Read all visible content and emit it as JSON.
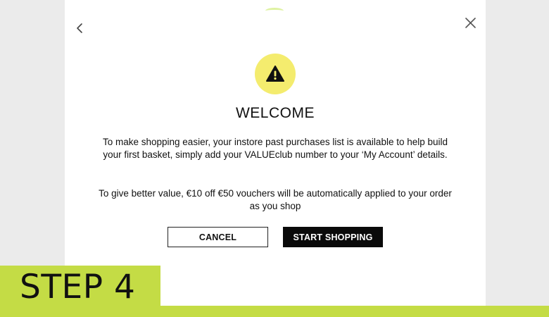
{
  "modal": {
    "title": "WELCOME",
    "paragraph1": "To make shopping easier, your instore past purchases list is available to help build your first basket, simply add your VALUEclub number to your ‘My Account’ details.",
    "paragraph2": "To give better value, €10 off €50 vouchers will be automatically applied to your order as you shop",
    "cancel_label": "CANCEL",
    "start_label": "START SHOPPING"
  },
  "step": {
    "label": "STEP 4"
  },
  "icons": {
    "back": "chevron-left-icon",
    "close": "close-icon",
    "warning": "warning-icon"
  },
  "colors": {
    "accent_green": "#c4dc45",
    "warning_yellow": "#f4ec6e",
    "primary_button": "#0a0a0a",
    "backdrop": "#ebebeb"
  }
}
